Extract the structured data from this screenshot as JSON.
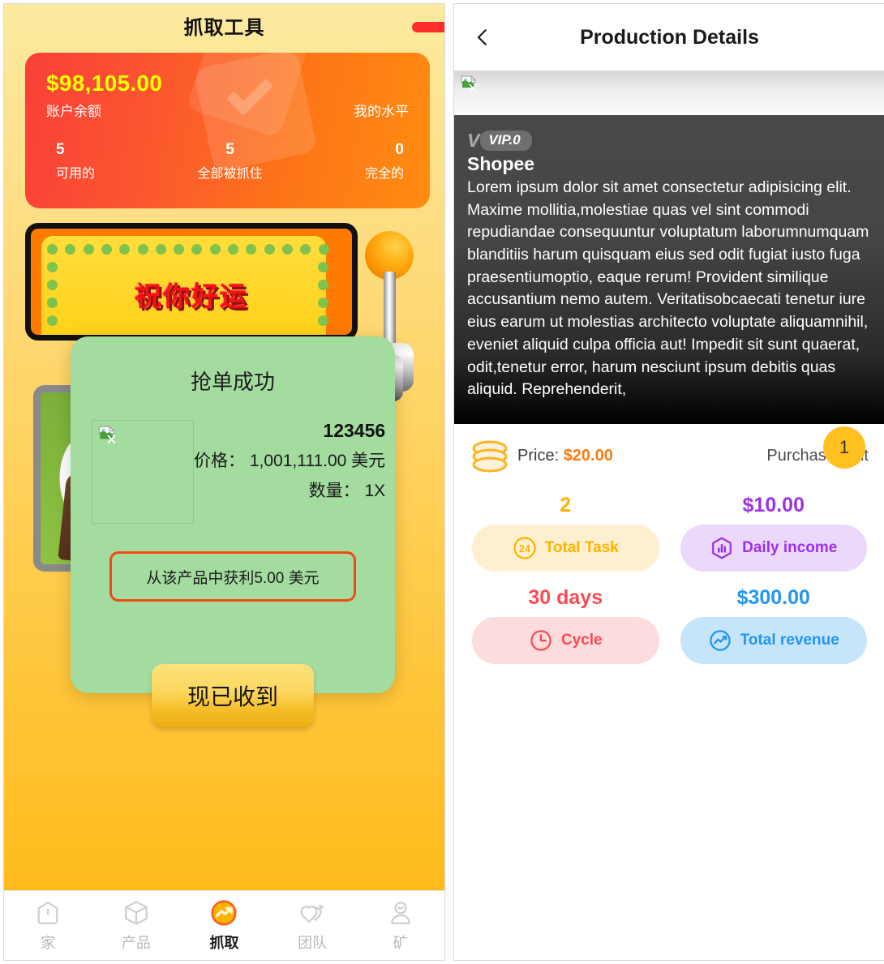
{
  "left": {
    "header": {
      "title": "抓取工具"
    },
    "balance": {
      "amount": "$98,105.00",
      "amount_label": "账户余额",
      "level_label": "我的水平",
      "stats": [
        {
          "num": "5",
          "caption": "可用的"
        },
        {
          "num": "5",
          "caption": "全部被抓住"
        },
        {
          "num": "0",
          "caption": "完全的"
        }
      ]
    },
    "machine": {
      "lucky_text": "祝你好运"
    },
    "nav": [
      {
        "label": "家",
        "icon": "home-icon",
        "active": false
      },
      {
        "label": "产品",
        "icon": "cube-icon",
        "active": false
      },
      {
        "label": "抓取",
        "icon": "grab-icon",
        "active": true
      },
      {
        "label": "团队",
        "icon": "team-heart-icon",
        "active": false
      },
      {
        "label": "矿",
        "icon": "mine-icon",
        "active": false
      }
    ],
    "modal": {
      "title": "抢单成功",
      "code": "123456",
      "price_line": "价格： 1,001,111.00 美元",
      "qty_line": "数量： 1X",
      "profit_text": "从该产品中获利5.00 美元",
      "button_label": "现已收到"
    }
  },
  "right": {
    "header": {
      "title": "Production Details",
      "back_icon": "chevron-left-icon"
    },
    "product": {
      "vip_v": "V",
      "vip_level": "VIP.0",
      "name": "Shopee",
      "description": "Lorem ipsum dolor sit amet consectetur adipisicing elit. Maxime mollitia,molestiae quas vel sint commodi repudiandae consequuntur voluptatum laborumnumquam blanditiis harum quisquam eius sed odit fugiat iusto fuga praesentiumoptio, eaque rerum! Provident similique accusantium nemo autem. Veritatisobcaecati tenetur iure eius earum ut molestias architecto voluptate aliquamnihil, eveniet aliquid culpa officia aut! Impedit sit sunt quaerat, odit,tenetur error, harum nesciunt ipsum debitis quas aliquid. Reprehenderit,"
    },
    "price": {
      "label": "Price:",
      "value": "$20.00",
      "limit_label": "Purchase limit",
      "limit_value": "1"
    },
    "stats": [
      {
        "value": "2",
        "label": "Total Task",
        "icon": "task-24-icon",
        "color": "#ffb400",
        "bg": "#fdefcf"
      },
      {
        "value": "$10.00",
        "label": "Daily income",
        "icon": "bar-chart-hex-icon",
        "color": "#9b32e8",
        "bg": "#ecd8fb"
      },
      {
        "value": "30 days",
        "label": "Cycle",
        "icon": "clock-icon",
        "color": "#fa4b55",
        "bg": "#fcdcdd"
      },
      {
        "value": "$300.00",
        "label": "Total revenue",
        "icon": "line-chart-circle-icon",
        "color": "#2196f3",
        "bg": "#c6e5fb"
      }
    ]
  }
}
